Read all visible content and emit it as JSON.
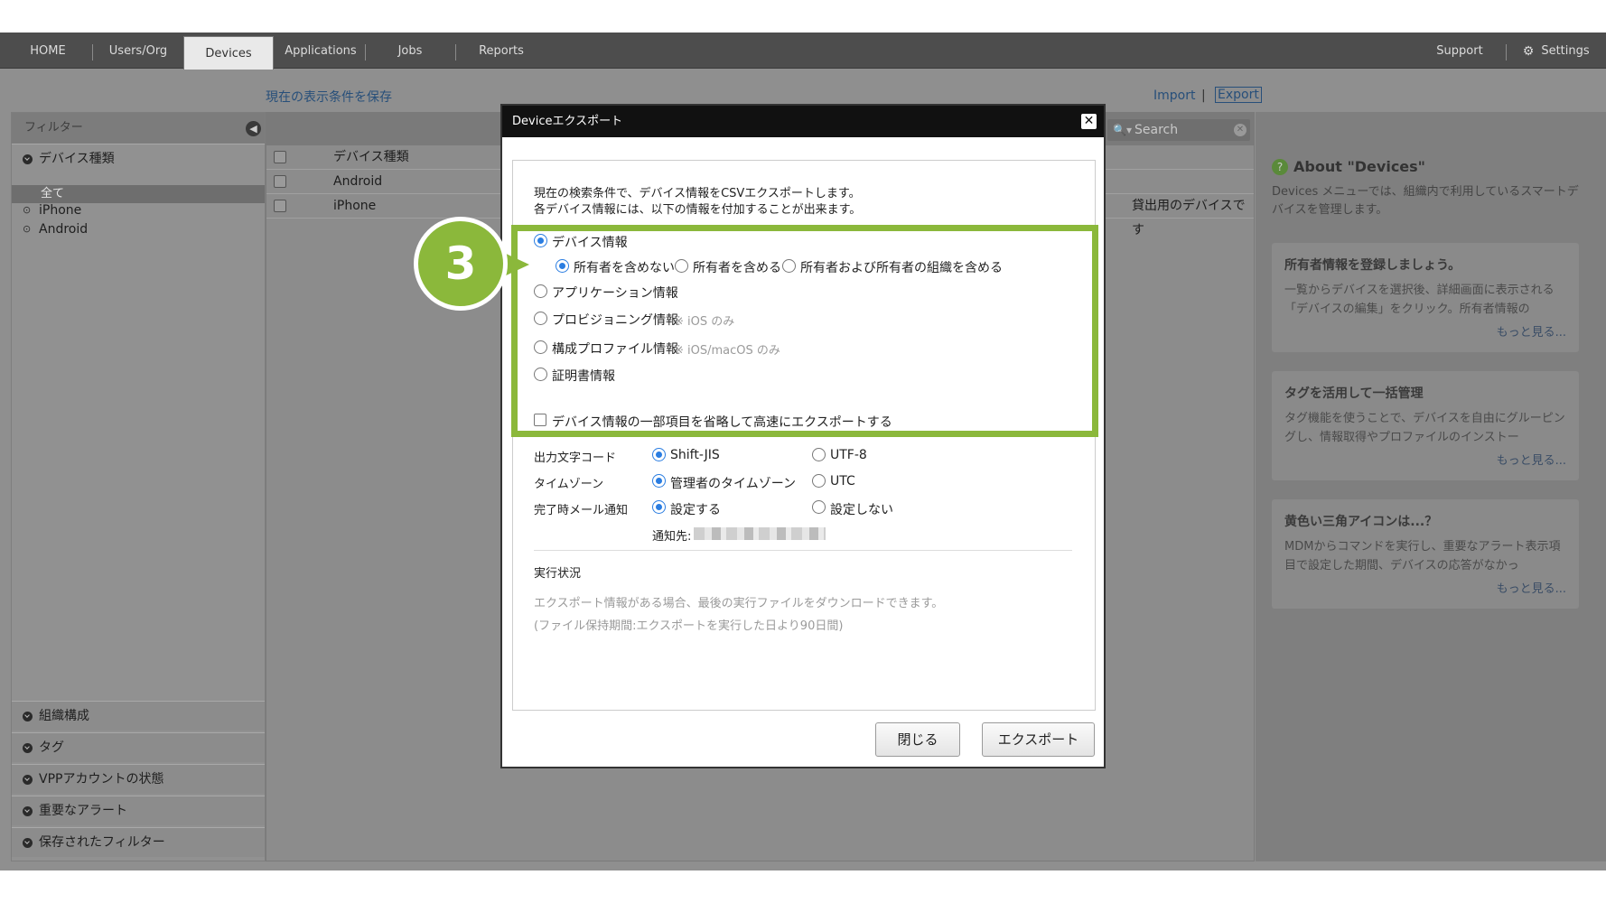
{
  "nav": {
    "home": "HOME",
    "users": "Users/Org",
    "devices": "Devices",
    "applications": "Applications",
    "jobs": "Jobs",
    "reports": "Reports",
    "support": "Support",
    "settings": "Settings"
  },
  "links": {
    "save_view": "現在の表示条件を保存",
    "import": "Import",
    "separator": "|",
    "export": "Export"
  },
  "sidebar": {
    "filter_title": "フィルター",
    "device_type": "デバイス種類",
    "items": [
      "全て",
      "iPhone",
      "Android"
    ],
    "bottom": [
      "組織構成",
      "タグ",
      "VPPアカウントの状態",
      "重要なアラート",
      "保存されたフィルター"
    ]
  },
  "table": {
    "col_device_type": "デバイス種類",
    "rows": [
      {
        "type": "Android"
      },
      {
        "type": "iPhone",
        "note": "貸出用のデバイスです"
      }
    ]
  },
  "search": {
    "placeholder": "Search"
  },
  "right": {
    "about_title": "About \"Devices\"",
    "about_body": "Devices メニューでは、組織内で利用しているスマートデバイスを管理します。",
    "cards": [
      {
        "title": "所有者情報を登録しましょう。",
        "body": "一覧からデバイスを選択後、詳細画面に表示される「デバイスの編集」をクリック。所有者情報の",
        "more": "もっと見る..."
      },
      {
        "title": "タグを活用して一括管理",
        "body": "タグ機能を使うことで、デバイスを自由にグルーピングし、情報取得やプロファイルのインストー",
        "more": "もっと見る..."
      },
      {
        "title": "黄色い三角アイコンは...？",
        "body": "MDMからコマンドを実行し、重要なアラート表示項目で設定した期間、デバイスの応答がなかっ",
        "more": "もっと見る..."
      }
    ]
  },
  "dialog": {
    "title": "Deviceエクスポート",
    "desc1": "現在の検索条件で、デバイス情報をCSVエクスポートします。",
    "desc2": "各デバイス情報には、以下の情報を付加することが出来ます。",
    "opt_device": "デバイス情報",
    "sub_no_owner": "所有者を含めない",
    "sub_owner": "所有者を含める",
    "sub_owner_org": "所有者および所有者の組織を含める",
    "opt_app": "アプリケーション情報",
    "opt_prov": "プロビジョニング情報",
    "note_ios": "※ iOS のみ",
    "opt_profile": "構成プロファイル情報",
    "note_ios_mac": "※ iOS/macOS のみ",
    "opt_cert": "証明書情報",
    "fast_export": "デバイス情報の一部項目を省略して高速にエクスポートする",
    "encoding_label": "出力文字コード",
    "enc_sjis": "Shift-JIS",
    "enc_utf8": "UTF-8",
    "tz_label": "タイムゾーン",
    "tz_admin": "管理者のタイムゾーン",
    "tz_utc": "UTC",
    "mail_label": "完了時メール通知",
    "mail_on": "設定する",
    "mail_off": "設定しない",
    "notify_to": "通知先:",
    "status_title": "実行状況",
    "status_desc1": "エクスポート情報がある場合、最後の実行ファイルをダウンロードできます。",
    "status_desc2": "(ファイル保持期間:エクスポートを実行した日より90日間)",
    "close_btn": "閉じる",
    "export_btn": "エクスポート"
  },
  "step": "3",
  "colors": {
    "highlight": "#8bb83b",
    "radio": "#2a7de1"
  }
}
